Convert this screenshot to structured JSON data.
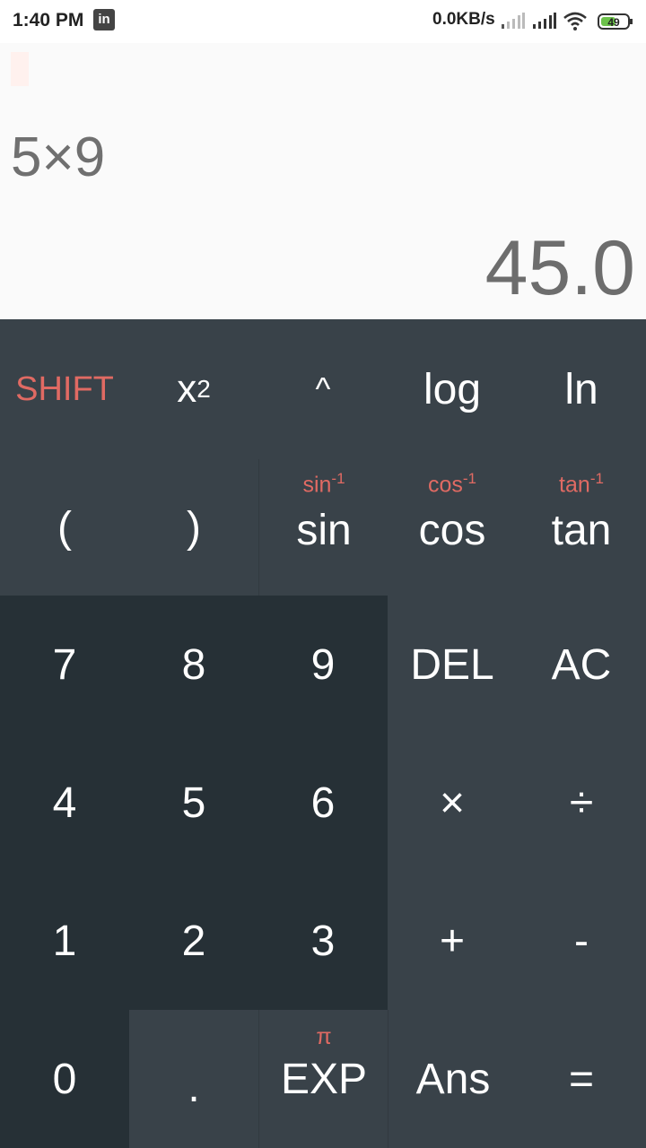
{
  "status": {
    "time": "1:40 PM",
    "app_icon": "in",
    "net_speed": "0.0KB/s",
    "battery": "49"
  },
  "display": {
    "expression": "5×9",
    "result": "45.0"
  },
  "keys": {
    "shift": "SHIFT",
    "square_base": "x",
    "square_exp": "2",
    "power": "^",
    "log": "log",
    "ln": "ln",
    "lparen": "(",
    "rparen": ")",
    "sin": "sin",
    "sin_alt_base": "sin",
    "sin_alt_exp": "-1",
    "cos": "cos",
    "cos_alt_base": "cos",
    "cos_alt_exp": "-1",
    "tan": "tan",
    "tan_alt_base": "tan",
    "tan_alt_exp": "-1",
    "seven": "7",
    "eight": "8",
    "nine": "9",
    "del": "DEL",
    "ac": "AC",
    "four": "4",
    "five": "5",
    "six": "6",
    "mul": "×",
    "div": "÷",
    "one": "1",
    "two": "2",
    "three": "3",
    "plus": "+",
    "minus": "-",
    "zero": "0",
    "dot": ".",
    "exp": "EXP",
    "exp_alt": "π",
    "ans": "Ans",
    "equals": "="
  },
  "colors": {
    "accent": "#e06a63",
    "pad": "#394249",
    "numpad": "#263036",
    "display_bg": "#fafafa"
  }
}
